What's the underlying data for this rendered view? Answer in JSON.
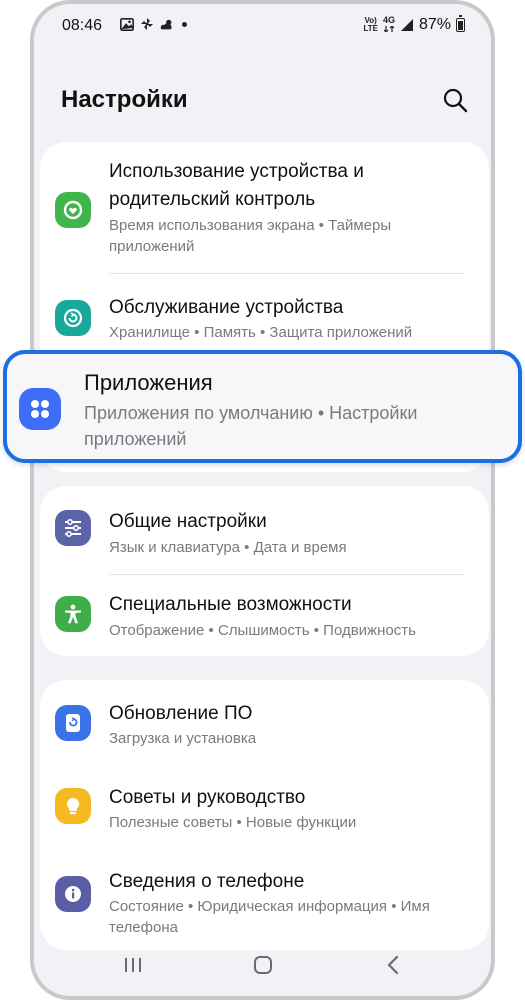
{
  "status_bar": {
    "time": "08:46",
    "volte": "Vo)\nLTE",
    "network": "4G",
    "battery": "87%"
  },
  "header": {
    "title": "Настройки"
  },
  "card1": {
    "items": [
      {
        "title": "Использование устройства и родительский контроль",
        "subtitle": "Время использования экрана • Таймеры приложений",
        "icon": "digital-wellbeing-icon",
        "color": "#3fb54a"
      },
      {
        "title": "Обслуживание устройства",
        "subtitle": "Хранилище • Память • Защита приложений",
        "icon": "device-care-icon",
        "color": "#19a99a"
      }
    ]
  },
  "highlighted": {
    "title": "Приложения",
    "subtitle": "Приложения по умолчанию • Настройки приложений",
    "icon": "apps-icon",
    "color": "#3d6ef5",
    "border_color": "#1a6ee6"
  },
  "card2": {
    "items": [
      {
        "title": "Общие настройки",
        "subtitle": "Язык и клавиатура • Дата и время",
        "icon": "general-settings-icon",
        "color": "#5b64a8"
      },
      {
        "title": "Специальные возможности",
        "subtitle": "Отображение • Слышимость • Подвижность",
        "icon": "accessibility-icon",
        "color": "#3fae48"
      }
    ]
  },
  "card3": {
    "items": [
      {
        "title": "Обновление ПО",
        "subtitle": "Загрузка и установка",
        "icon": "software-update-icon",
        "color": "#3a73e8"
      },
      {
        "title": "Советы и руководство",
        "subtitle": "Полезные советы • Новые функции",
        "icon": "tips-bulb-icon",
        "color": "#f5b921"
      },
      {
        "title": "Сведения о телефоне",
        "subtitle": "Состояние • Юридическая информация • Имя телефона",
        "icon": "info-icon",
        "color": "#5b5ea6"
      }
    ]
  }
}
